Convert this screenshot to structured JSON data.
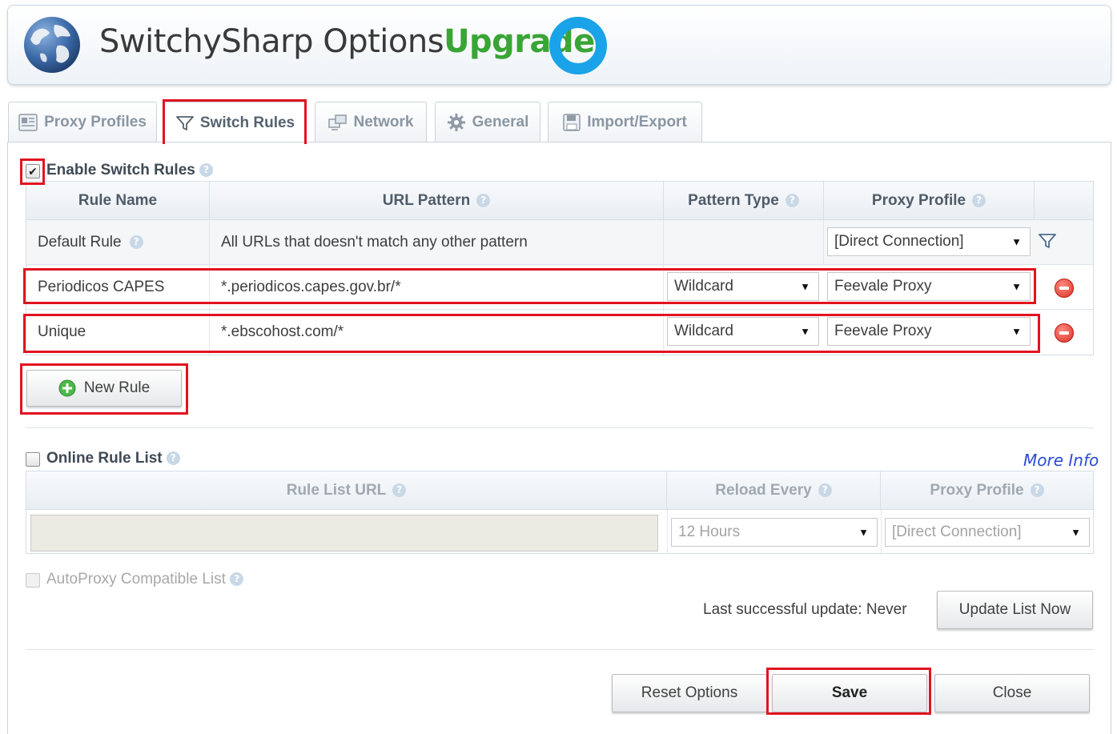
{
  "header": {
    "title": "SwitchySharp Options",
    "upgrade": "Upgrade"
  },
  "tabs": [
    {
      "label": "Proxy Profiles",
      "icon": "proxy-profiles-icon"
    },
    {
      "label": "Switch Rules",
      "icon": "funnel-icon",
      "active": true
    },
    {
      "label": "Network",
      "icon": "network-icon"
    },
    {
      "label": "General",
      "icon": "gear-icon"
    },
    {
      "label": "Import/Export",
      "icon": "floppy-disk-icon"
    }
  ],
  "switch_rules": {
    "enable_label": "Enable Switch Rules",
    "enabled": true,
    "headers": {
      "rule_name": "Rule Name",
      "url_pattern": "URL Pattern",
      "pattern_type": "Pattern Type",
      "proxy_profile": "Proxy Profile"
    },
    "default_rule": {
      "name": "Default Rule",
      "pattern": "All URLs that doesn't match any other pattern",
      "profile": "[Direct Connection]"
    },
    "rules": [
      {
        "name": "Periodicos CAPES",
        "pattern": "*.periodicos.capes.gov.br/*",
        "type": "Wildcard",
        "profile": "Feevale Proxy"
      },
      {
        "name": "Unique",
        "pattern": "*.ebscohost.com/*",
        "type": "Wildcard",
        "profile": "Feevale Proxy"
      }
    ],
    "new_rule_label": "New Rule"
  },
  "online_rule_list": {
    "label": "Online Rule List",
    "enabled": false,
    "more_info": "More Info",
    "headers": {
      "rule_list_url": "Rule List URL",
      "reload_every": "Reload Every",
      "proxy_profile": "Proxy Profile"
    },
    "url_value": "",
    "reload_value": "12 Hours",
    "profile_value": "[Direct Connection]",
    "autoproxy_label": "AutoProxy Compatible List",
    "last_update": "Last successful update: Never",
    "update_button": "Update List Now"
  },
  "footer": {
    "reset_label": "Reset Options",
    "save_label": "Save",
    "close_label": "Close"
  },
  "colors": {
    "highlight": "#e2131f",
    "upgrade_green": "#39a535",
    "ring_blue": "#1aa3e8",
    "link_blue": "#2a4bd7"
  }
}
